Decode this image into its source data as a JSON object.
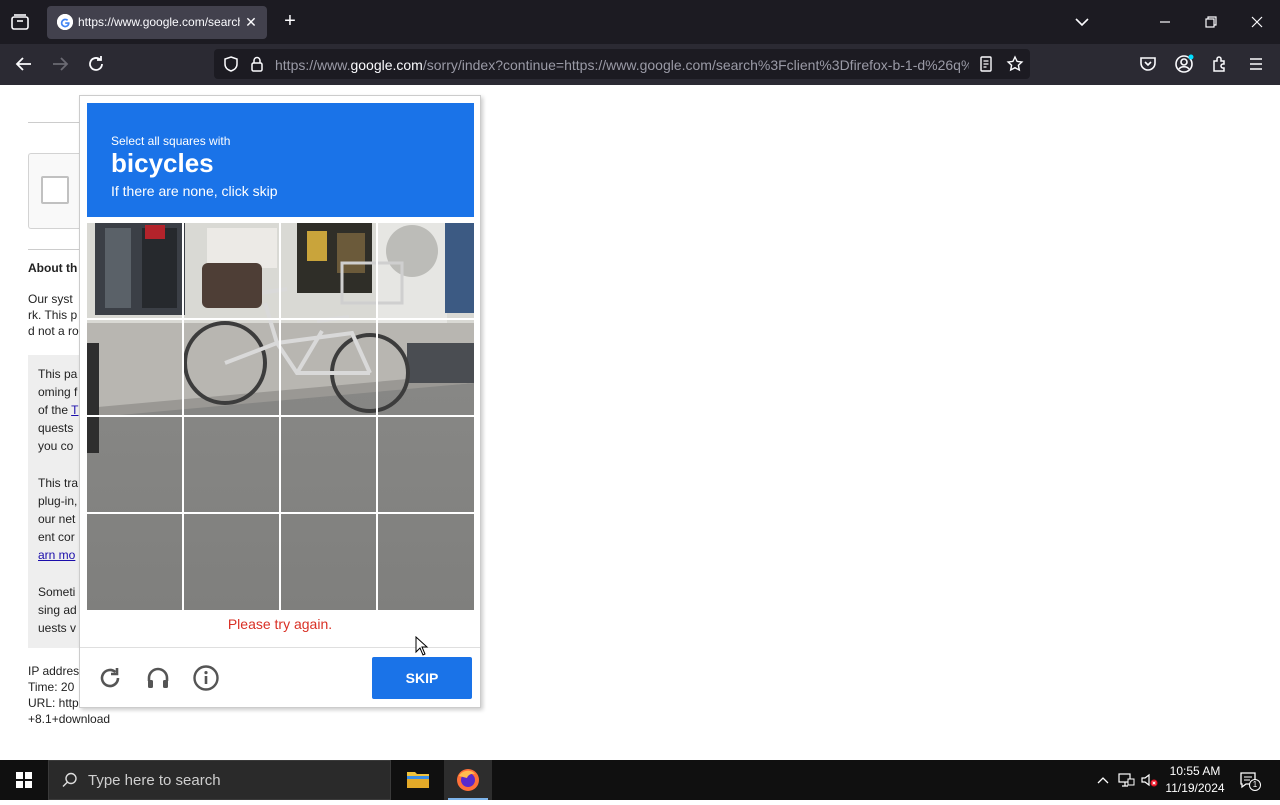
{
  "browser": {
    "tab": {
      "title": "https://www.google.com/search?client=firefox",
      "close": "✕"
    },
    "new_tab": "+",
    "url": {
      "domain": "https://www.google.com",
      "prefix": "https://www.",
      "host": "google.com",
      "path": "/sorry/index?continue=https://www.google.com/search%3Fclient%3Dfirefox-b-1-d%26q%"
    }
  },
  "page": {
    "about_heading": "About th",
    "para1": [
      "Our syst",
      "rk. This p",
      "d not a ro"
    ],
    "gray": {
      "block1": [
        "This pa",
        "oming f",
        "of the ",
        "quests",
        "you co"
      ],
      "block1_link": "T",
      "block2": [
        "This tra",
        "plug-in,",
        "our net",
        "ent cor"
      ],
      "block2_link": "arn mo",
      "block3": [
        "Someti",
        "sing ad",
        "uests v"
      ]
    },
    "footer_lines": [
      "IP addres",
      "Time: 20",
      "URL: http",
      "+8.1+download"
    ]
  },
  "captcha": {
    "instruction": "Select all squares with",
    "target": "bicycles",
    "hint": "If there are none, click skip",
    "error": "Please try again.",
    "skip_label": "SKIP",
    "footer_icons": [
      "reload-icon",
      "audio-icon",
      "info-icon"
    ]
  },
  "taskbar": {
    "search_placeholder": "Type here to search",
    "time": "10:55 AM",
    "date": "11/19/2024",
    "notification_count": "1"
  },
  "colors": {
    "captcha_blue": "#1a73e8",
    "error_red": "#d93025",
    "chrome_dark": "#1c1b22",
    "toolbar": "#2b2a33"
  }
}
